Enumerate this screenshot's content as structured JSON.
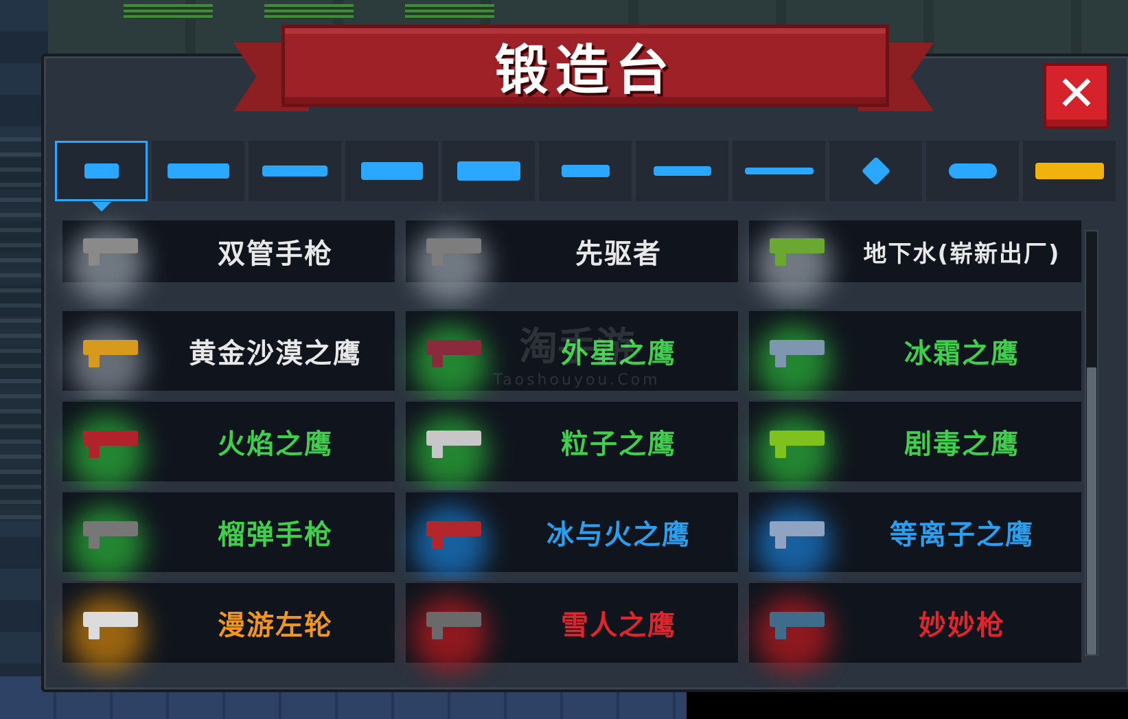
{
  "header": {
    "title": "锻造台",
    "close_label": "✕"
  },
  "tabs": [
    {
      "icon": "pistol-icon",
      "active": true
    },
    {
      "icon": "rifle-icon",
      "active": false
    },
    {
      "icon": "sniper-icon",
      "active": false
    },
    {
      "icon": "launcher-icon",
      "active": false
    },
    {
      "icon": "special-gun-icon",
      "active": false
    },
    {
      "icon": "bow-icon",
      "active": false
    },
    {
      "icon": "sword-icon",
      "active": false
    },
    {
      "icon": "spear-icon",
      "active": false
    },
    {
      "icon": "shuriken-icon",
      "active": false
    },
    {
      "icon": "fish-icon",
      "active": false
    },
    {
      "icon": "crown-icon",
      "active": false
    }
  ],
  "weapons": [
    {
      "name": "双管手枪",
      "color": "#e8e8e8",
      "glow": "#9aa3ad",
      "gun": "#8a8a8a"
    },
    {
      "name": "先驱者",
      "color": "#e8e8e8",
      "glow": "#9aa3ad",
      "gun": "#7d7d7d"
    },
    {
      "name": "地下水(崭新出厂)",
      "color": "#e8e8e8",
      "glow": "#9aa3ad",
      "gun": "#6aa832"
    },
    {
      "name": "黄金沙漠之鹰",
      "color": "#e8e8e8",
      "glow": "#8a939d",
      "gun": "#d89a1c"
    },
    {
      "name": "外星之鹰",
      "color": "#3fcf4a",
      "glow": "#2bb53a",
      "gun": "#8a2a3c"
    },
    {
      "name": "冰霜之鹰",
      "color": "#3fcf4a",
      "glow": "#2bb53a",
      "gun": "#7e96b0"
    },
    {
      "name": "火焰之鹰",
      "color": "#3fcf4a",
      "glow": "#2bb53a",
      "gun": "#b0232a"
    },
    {
      "name": "粒子之鹰",
      "color": "#3fcf4a",
      "glow": "#2bb53a",
      "gun": "#c7c7c7"
    },
    {
      "name": "剧毒之鹰",
      "color": "#3fcf4a",
      "glow": "#2bb53a",
      "gun": "#7fc21e"
    },
    {
      "name": "榴弹手枪",
      "color": "#3fcf4a",
      "glow": "#2bb53a",
      "gun": "#777777"
    },
    {
      "name": "冰与火之鹰",
      "color": "#2a9ff0",
      "glow": "#1a7fd6",
      "gun": "#b3262c"
    },
    {
      "name": "等离子之鹰",
      "color": "#2a9ff0",
      "glow": "#1a7fd6",
      "gun": "#8fa4c2"
    },
    {
      "name": "漫游左轮",
      "color": "#f0961e",
      "glow": "#d4860a",
      "gun": "#dcdcdc"
    },
    {
      "name": "雪人之鹰",
      "color": "#e0262c",
      "glow": "#c41a20",
      "gun": "#6a6a6a"
    },
    {
      "name": "妙妙枪",
      "color": "#e0262c",
      "glow": "#c41a20",
      "gun": "#3e6c8a"
    }
  ],
  "watermark": {
    "main": "淘手游",
    "sub": "Taoshouyou.Com"
  }
}
